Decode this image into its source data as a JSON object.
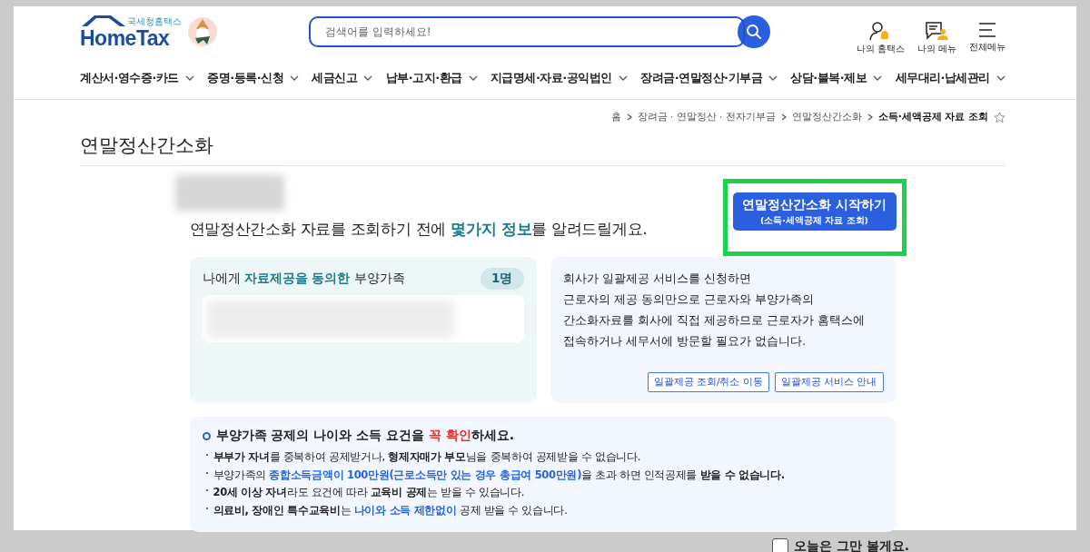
{
  "header": {
    "logo_caption": "국세청홈택스",
    "logo_text": "HomeTax",
    "search": {
      "placeholder": "검색어를 입력하세요!"
    },
    "utility_menu": [
      {
        "kind": "my-hometax",
        "label": "나의 홈택스"
      },
      {
        "kind": "my-menu",
        "label": "나의 메뉴"
      },
      {
        "kind": "all-menu",
        "label": "전체메뉴"
      }
    ]
  },
  "nav": [
    "계산서·영수증·카드",
    "증명·등록·신청",
    "세금신고",
    "납부·고지·환급",
    "지급명세·자료·공익법인",
    "장려금·연말정산·기부금",
    "상담·불복·제보",
    "세무대리·납세관리"
  ],
  "breadcrumb": {
    "items": [
      "홈",
      "장려금 · 연말정산 · 전자기부금",
      "연말정산간소화",
      "소득·세액공제 자료 조회"
    ]
  },
  "page_title": "연말정산간소화",
  "intro": [
    {
      "text": "연말정산간소화 자료를 조회하기 전에 ",
      "kind": "text"
    },
    {
      "text": "몇가지 정보",
      "kind": "highlight"
    },
    {
      "text": "를 알려드릴게요.",
      "kind": "text"
    }
  ],
  "start_button": {
    "label": "연말정산간소화 시작하기",
    "sub_label": "(소득·세액공제 자료 조회)",
    "highlighted": true
  },
  "consent_card": {
    "title": [
      {
        "text": "나에게 ",
        "kind": "text"
      },
      {
        "text": "자료제공을 동의한",
        "kind": "highlight"
      },
      {
        "text": " 부양가족",
        "kind": "text"
      }
    ],
    "count": "1명"
  },
  "info_card": {
    "lines": [
      "회사가 일괄제공 서비스를 신청하면",
      "근로자의 제공 동의만으로 근로자와 부양가족의",
      "간소화자료를 회사에 직접 제공하므로 근로자가 홈택스에",
      "접속하거나 세무서에 방문할 필요가 없습니다."
    ],
    "buttons": [
      "일괄제공 조회/취소 이동",
      "일괄제공 서비스 안내"
    ]
  },
  "notice": {
    "title": [
      {
        "text": "부양가족 공제의 나이와 소득 요건을 ",
        "kind": "strong"
      },
      {
        "text": "꼭 확인",
        "kind": "warning"
      },
      {
        "text": "하세요.",
        "kind": "strong"
      }
    ],
    "items": [
      [
        {
          "text": "부부가 자녀",
          "kind": "strong"
        },
        {
          "text": "를 중복하여 공제받거나, ",
          "kind": "text"
        },
        {
          "text": "형제자매가 부모",
          "kind": "strong"
        },
        {
          "text": "님을 중복하여 공제받을 수 없습니다.",
          "kind": "text"
        }
      ],
      [
        {
          "text": "부양가족의 ",
          "kind": "text"
        },
        {
          "text": "종합소득금액이 100만원(근로소득만 있는 경우 총급여 500만원)",
          "kind": "highlight"
        },
        {
          "text": "을 초과 하면 인적공제를 ",
          "kind": "text"
        },
        {
          "text": "받을 수 없습니다.",
          "kind": "strong"
        }
      ],
      [
        {
          "text": "20세 이상 자녀",
          "kind": "strong"
        },
        {
          "text": "라도 요건에 따라 ",
          "kind": "text"
        },
        {
          "text": "교육비 공제",
          "kind": "strong"
        },
        {
          "text": "는 받을 수 있습니다.",
          "kind": "text"
        }
      ],
      [
        {
          "text": "의료비, 장애인 특수교육비",
          "kind": "strong"
        },
        {
          "text": "는 ",
          "kind": "text"
        },
        {
          "text": "나이와 소득 제한없이",
          "kind": "highlight"
        },
        {
          "text": " 공제 받을 수 있습니다.",
          "kind": "text"
        }
      ]
    ]
  },
  "dismiss": {
    "label": "오늘은 그만 볼게요.",
    "checked": false
  }
}
